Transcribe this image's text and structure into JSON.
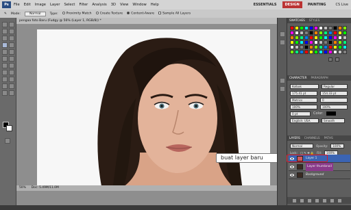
{
  "app": {
    "logo_text": "Ps",
    "menus": [
      "File",
      "Edit",
      "Image",
      "Layer",
      "Select",
      "Filter",
      "Analysis",
      "3D",
      "View",
      "Window",
      "Help"
    ],
    "workspaces": [
      "ESSENTIALS",
      "DESIGN",
      "PAINTING"
    ],
    "workspace_active": "DESIGN",
    "cs_live": "CS Live"
  },
  "options": {
    "mode_label": "Mode:",
    "mode_value": "Normal",
    "type_label": "Type:",
    "radio1": "Proximity Match",
    "radio2": "Create Texture",
    "radio3": "Content-Aware",
    "sample_all": "Sample All Layers"
  },
  "document": {
    "tab_title": "pengaa foto Baru (Fudgy @ 56% (Layer 1, RGB/8)) *",
    "zoom": "50%",
    "doc_info": "Doc: 5.49M/11.0M"
  },
  "callout": {
    "text": "buat layer baru"
  },
  "panels": {
    "swatches_tabs": [
      "SWATCHES",
      "STYLES"
    ],
    "char_tabs": [
      "CHARACTER",
      "PARAGRAPH"
    ],
    "font_family": "Kolbak",
    "font_style": "Regular",
    "font_size": "175.41 pt",
    "leading": "154.33 pt",
    "kerning": "Metrics",
    "tracking": "0",
    "scale_v": "100%",
    "scale_h": "100%",
    "baseline": "0 pt",
    "color_label": "Color:",
    "language": "English: USA",
    "aa": "Smooth",
    "layers_tabs": [
      "LAYERS",
      "CHANNELS",
      "PATHS"
    ],
    "blend_mode": "Normal",
    "opacity_label": "Opacity:",
    "opacity_value": "100%",
    "lock_label": "Lock:",
    "fill_label": "Fill:",
    "fill_value": "100%",
    "layers": [
      "Layer 1",
      "Layer thumbnail",
      "Background"
    ]
  },
  "colors": {
    "accent": "#3b64b3",
    "highlight": "#e0162b",
    "layer_fill": "#d05a5a"
  }
}
